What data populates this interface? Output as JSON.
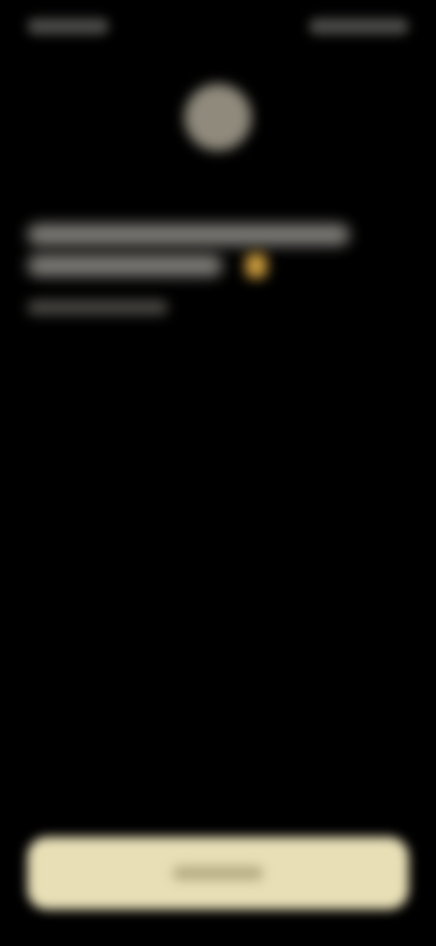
{
  "status_bar": {
    "time": "",
    "icons": [
      "signal-icon",
      "wifi-icon",
      "battery-icon"
    ]
  },
  "header": {
    "avatar_color": "#8f8a7c"
  },
  "message": {
    "line1": "",
    "line2": "",
    "emoji_color": "#c99a3d",
    "subtext": ""
  },
  "cta": {
    "label": "",
    "background": "#e8dfb6"
  }
}
